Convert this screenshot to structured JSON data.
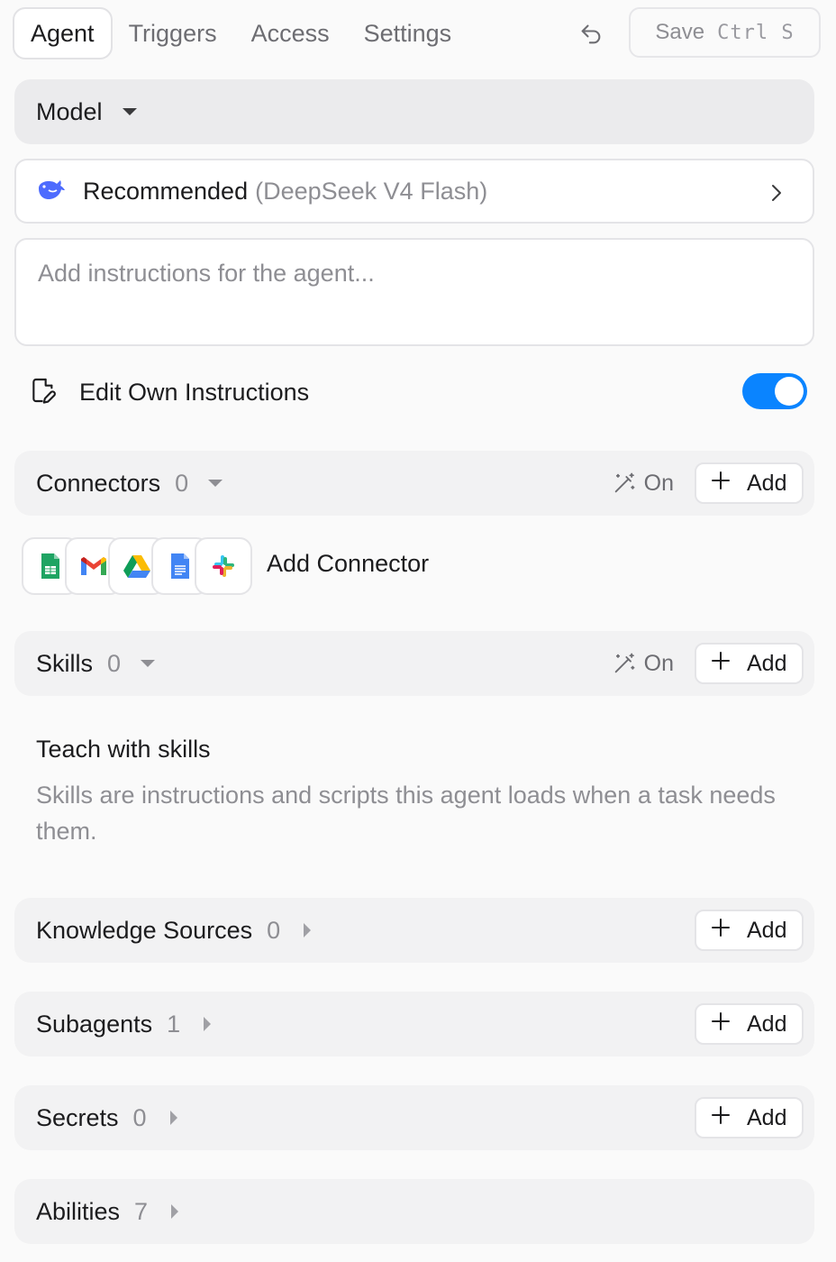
{
  "tabs": [
    {
      "label": "Agent",
      "active": true
    },
    {
      "label": "Triggers",
      "active": false
    },
    {
      "label": "Access",
      "active": false
    },
    {
      "label": "Settings",
      "active": false
    }
  ],
  "toolbar": {
    "save_label": "Save",
    "save_shortcut": "Ctrl S"
  },
  "model": {
    "section_label": "Model",
    "selected_name": "Recommended",
    "selected_detail": "(DeepSeek V4 Flash)"
  },
  "instructions": {
    "placeholder": "Add instructions for the agent..."
  },
  "edit_own_instructions": {
    "label": "Edit Own Instructions",
    "enabled": true,
    "toggle_color": "#0a84ff"
  },
  "connectors": {
    "label": "Connectors",
    "count": "0",
    "on_label": "On",
    "add_label": "Add",
    "apps": [
      "google-sheets-icon",
      "gmail-icon",
      "google-drive-icon",
      "google-docs-icon",
      "slack-icon"
    ],
    "add_connector_label": "Add Connector"
  },
  "skills": {
    "label": "Skills",
    "count": "0",
    "on_label": "On",
    "add_label": "Add",
    "teach_title": "Teach with skills",
    "teach_text": "Skills are instructions and scripts this agent loads when a task needs them."
  },
  "knowledge_sources": {
    "label": "Knowledge Sources",
    "count": "0",
    "add_label": "Add"
  },
  "subagents": {
    "label": "Subagents",
    "count": "1",
    "add_label": "Add"
  },
  "secrets": {
    "label": "Secrets",
    "count": "0",
    "add_label": "Add"
  },
  "abilities": {
    "label": "Abilities",
    "count": "7"
  }
}
